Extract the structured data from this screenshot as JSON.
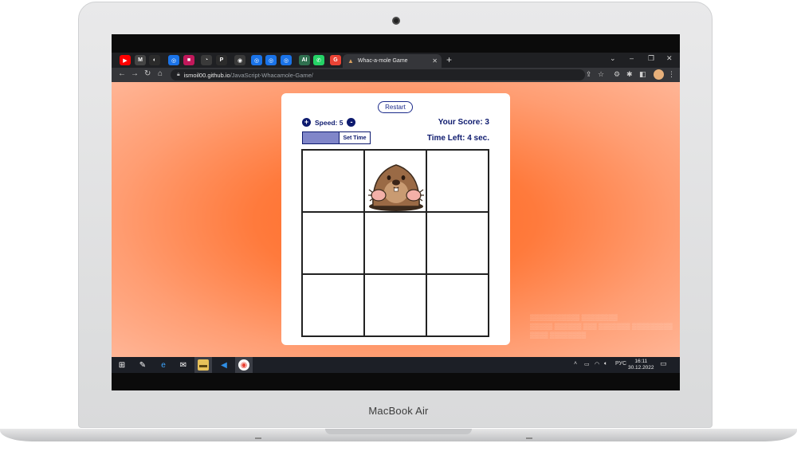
{
  "device": {
    "brand_label": "MacBook Air"
  },
  "browser": {
    "tabs_pinned": [
      {
        "icon": "youtube-icon",
        "color": "#ff0000",
        "glyph": "▶"
      },
      {
        "icon": "medium-icon",
        "color": "#444444",
        "glyph": "M"
      },
      {
        "icon": "github-icon",
        "color": "#2b2b2b",
        "glyph": "◐"
      },
      {
        "icon": "chrome-blue-icon",
        "color": "#1a73e8",
        "glyph": "◎"
      },
      {
        "icon": "purple-app-icon",
        "color": "#c2185b",
        "glyph": "■"
      },
      {
        "icon": "clock-icon",
        "color": "#3a3a3a",
        "glyph": "◔"
      },
      {
        "icon": "pdf-icon",
        "color": "#2b2b2b",
        "glyph": "P"
      },
      {
        "icon": "browser-icon",
        "color": "#3a3a3a",
        "glyph": "◉"
      },
      {
        "icon": "chrome-blue-icon",
        "color": "#1a73e8",
        "glyph": "◎"
      },
      {
        "icon": "chrome-blue-icon",
        "color": "#1a73e8",
        "glyph": "◎"
      },
      {
        "icon": "chrome-blue-icon",
        "color": "#1a73e8",
        "glyph": "◎"
      },
      {
        "icon": "ai-icon",
        "color": "#2f6f4f",
        "glyph": "AI"
      },
      {
        "icon": "whatsapp-icon",
        "color": "#25d366",
        "glyph": "✆"
      },
      {
        "icon": "google-icon",
        "color": "#ea4335",
        "glyph": "G"
      }
    ],
    "active_tab": {
      "title": "Whac-a-mole Game",
      "favicon": "mole-icon"
    },
    "url": {
      "host": "ismoil00.github.io",
      "path": "/JavaScript-Whacamole-Game/"
    }
  },
  "game": {
    "restart_label": "Restart",
    "speed_label": "Speed: 5",
    "speed_increase": "+",
    "speed_decrease": "-",
    "score_label": "Your Score: 3",
    "set_time_label": "Set Time",
    "time_left_label": "Time Left: 4 sec.",
    "mole_cell": 2,
    "cells": 9
  },
  "taskbar": {
    "apps": [
      "windows-start-icon",
      "paint-icon",
      "edge-icon",
      "mail-icon",
      "file-explorer-icon",
      "vscode-icon",
      "chrome-icon"
    ],
    "tray_lang": "РУС",
    "time": "16:11",
    "date": "30.12.2022"
  },
  "colors": {
    "accent": "#0d1a6e",
    "page_bg": "#ff6a24",
    "time_fill": "#8086c9"
  }
}
